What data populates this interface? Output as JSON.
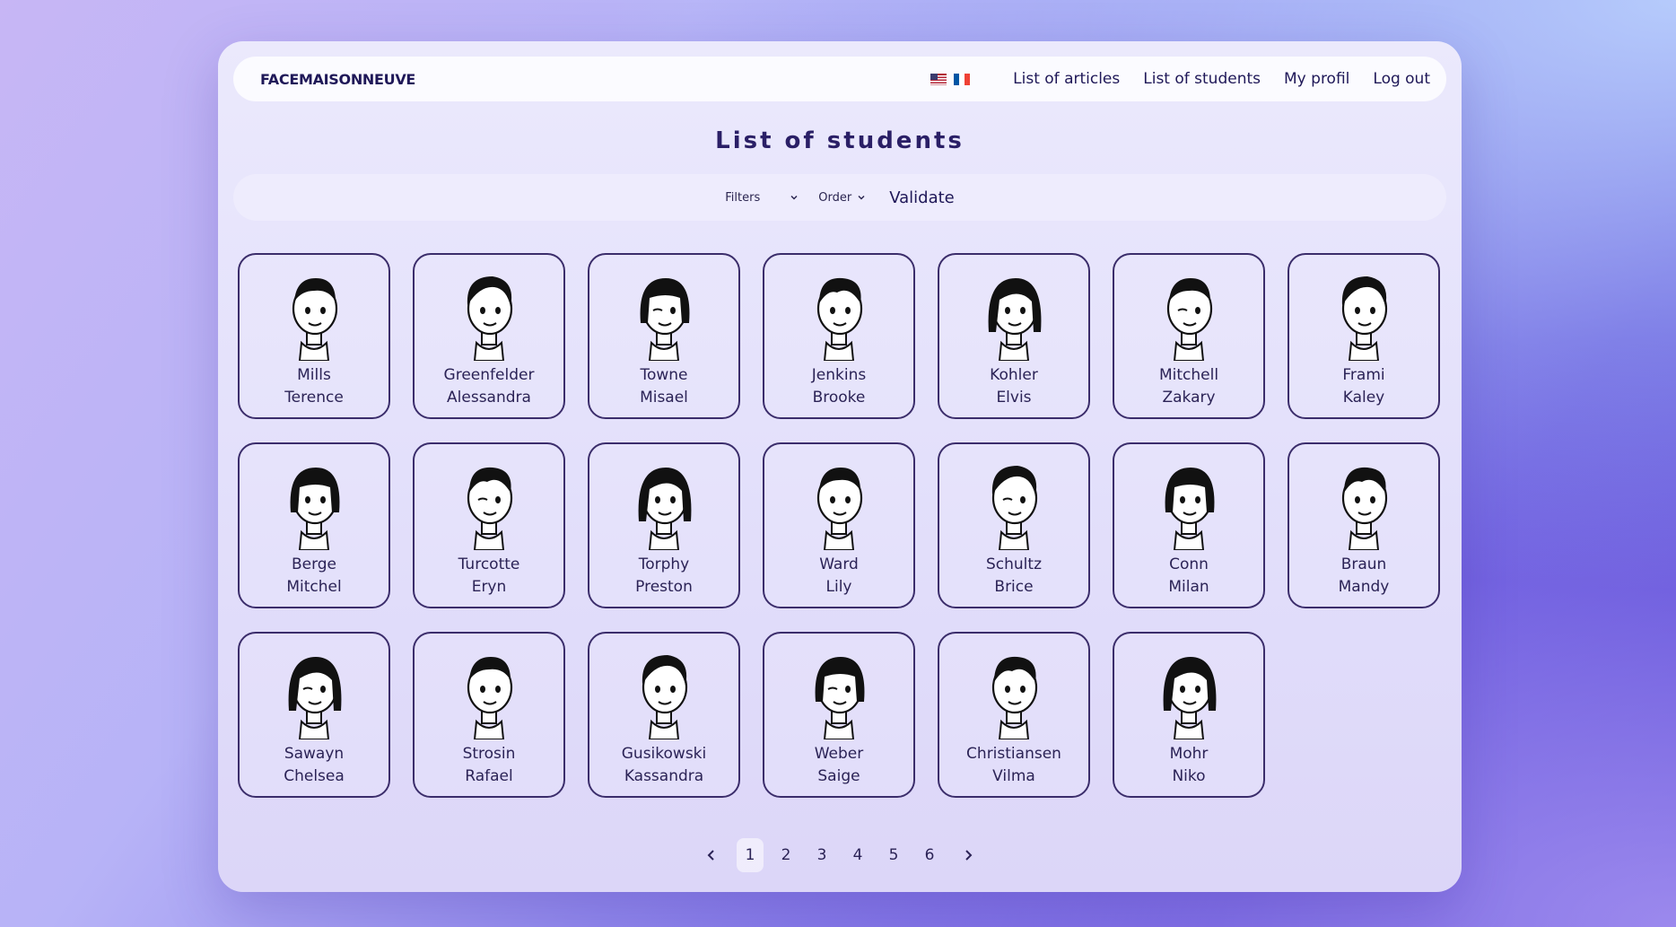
{
  "navbar": {
    "brand": "FACEMAISONNEUVE",
    "links": [
      "List of articles",
      "List of students",
      "My profil",
      "Log out"
    ],
    "flags": [
      "us-flag-icon",
      "fr-flag-icon"
    ]
  },
  "page": {
    "title": "List of students"
  },
  "filter_bar": {
    "filters_label": "Filters",
    "order_label": "Order",
    "validate_label": "Validate"
  },
  "students": [
    {
      "last": "Mills",
      "first": "Terence"
    },
    {
      "last": "Greenfelder",
      "first": "Alessandra"
    },
    {
      "last": "Towne",
      "first": "Misael"
    },
    {
      "last": "Jenkins",
      "first": "Brooke"
    },
    {
      "last": "Kohler",
      "first": "Elvis"
    },
    {
      "last": "Mitchell",
      "first": "Zakary"
    },
    {
      "last": "Frami",
      "first": "Kaley"
    },
    {
      "last": "Berge",
      "first": "Mitchel"
    },
    {
      "last": "Turcotte",
      "first": "Eryn"
    },
    {
      "last": "Torphy",
      "first": "Preston"
    },
    {
      "last": "Ward",
      "first": "Lily"
    },
    {
      "last": "Schultz",
      "first": "Brice"
    },
    {
      "last": "Conn",
      "first": "Milan"
    },
    {
      "last": "Braun",
      "first": "Mandy"
    },
    {
      "last": "Sawayn",
      "first": "Chelsea"
    },
    {
      "last": "Strosin",
      "first": "Rafael"
    },
    {
      "last": "Gusikowski",
      "first": "Kassandra"
    },
    {
      "last": "Weber",
      "first": "Saige"
    },
    {
      "last": "Christiansen",
      "first": "Vilma"
    },
    {
      "last": "Mohr",
      "first": "Niko"
    }
  ],
  "pagination": {
    "pages": [
      "1",
      "2",
      "3",
      "4",
      "5",
      "6"
    ],
    "current": "1"
  }
}
